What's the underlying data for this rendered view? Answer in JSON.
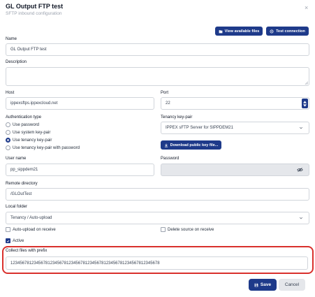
{
  "dialog": {
    "title": "GL Output FTP test",
    "subtitle": "SFTP inbound configuration"
  },
  "buttons": {
    "view_files": "View available files",
    "test_connection": "Test connection",
    "download_key": "Download public key file...",
    "save": "Save",
    "cancel": "Cancel"
  },
  "fields": {
    "name": {
      "label": "Name",
      "value": "GL Output FTP test"
    },
    "description": {
      "label": "Description",
      "value": ""
    },
    "host": {
      "label": "Host",
      "value": "ippexsftps.ippexcloud.net"
    },
    "port": {
      "label": "Port",
      "value": "22"
    },
    "auth_type": {
      "label": "Authentication type",
      "options": [
        "Use password",
        "Use system key-pair",
        "Use tenancy key-pair",
        "Use tenancy key-pair with password"
      ],
      "selected": "Use tenancy key-pair"
    },
    "tenancy_keypair": {
      "label": "Tenancy key-pair",
      "value": "IPPEX sFTP Server for SIPPDEM21"
    },
    "username": {
      "label": "User name",
      "value": "pp_sippdem21"
    },
    "password": {
      "label": "Password",
      "value": ""
    },
    "remote_dir": {
      "label": "Remote directory",
      "value": "/GLOutTest"
    },
    "local_folder": {
      "label": "Local folder",
      "value": "Tenancy / Auto-upload"
    },
    "auto_upload": {
      "label": "Auto-upload on receive",
      "checked": false
    },
    "delete_source": {
      "label": "Delete source on receive",
      "checked": false
    },
    "active": {
      "label": "Active",
      "checked": true
    },
    "prefix": {
      "label": "Collect files with prefix",
      "value": "1234567812345678123456781234567812345678123456781234567812345678"
    }
  },
  "icons": {
    "close": "close-icon",
    "folder": "folder-icon",
    "plug": "plug-icon",
    "download": "download-icon",
    "eye_off": "eye-off-icon",
    "chevron": "chevron-down-icon",
    "save": "save-icon"
  },
  "colors": {
    "primary": "#1e3a8a",
    "highlight": "#d9302c",
    "cancel_bg": "#e5e7eb"
  }
}
